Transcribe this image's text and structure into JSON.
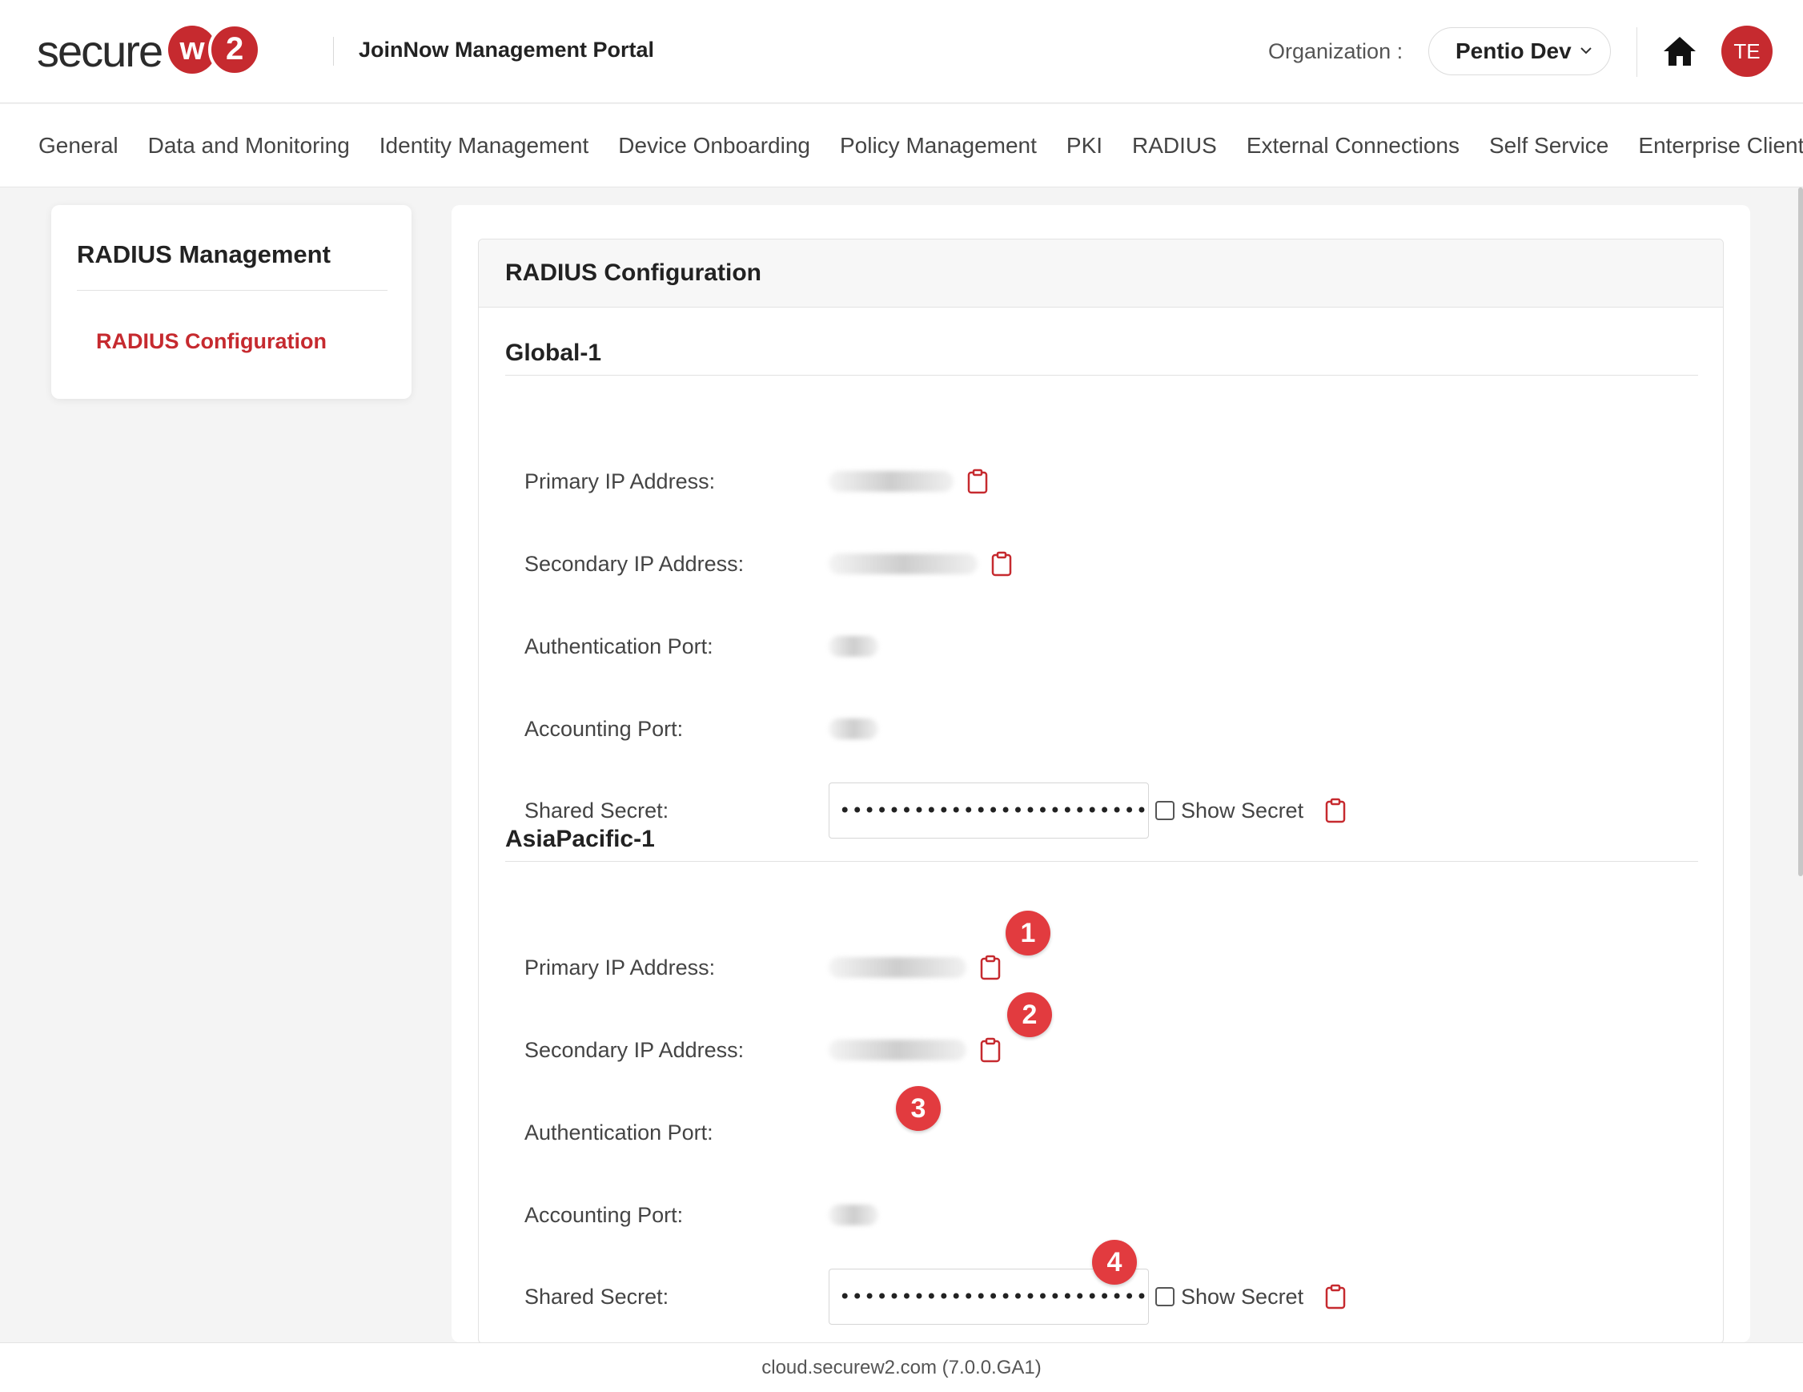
{
  "brand": {
    "logo_word": "secure",
    "logo_w": "w",
    "logo_2": "2",
    "accent_color": "#c62a2f"
  },
  "header": {
    "portal_title": "JoinNow Management Portal",
    "org_label": "Organization :",
    "org_value": "Pentio Dev",
    "avatar_initials": "TE"
  },
  "nav": {
    "items": [
      "General",
      "Data and Monitoring",
      "Identity Management",
      "Device Onboarding",
      "Policy Management",
      "PKI",
      "RADIUS",
      "External Connections",
      "Self Service",
      "Enterprise Client"
    ]
  },
  "sidebar": {
    "title": "RADIUS Management",
    "link": "RADIUS Configuration"
  },
  "card": {
    "title": "RADIUS Configuration"
  },
  "sections": [
    {
      "title": "Global-1",
      "primary_ip_label": "Primary IP Address:",
      "secondary_ip_label": "Secondary IP Address:",
      "auth_port_label": "Authentication Port:",
      "acct_port_label": "Accounting Port:",
      "shared_secret_label": "Shared Secret:",
      "shared_secret_value": "••••••••••••••••••••••••••••••",
      "show_secret_label": "Show Secret"
    },
    {
      "title": "AsiaPacific-1",
      "primary_ip_label": "Primary IP Address:",
      "secondary_ip_label": "Secondary IP Address:",
      "auth_port_label": "Authentication Port:",
      "acct_port_label": "Accounting Port:",
      "shared_secret_label": "Shared Secret:",
      "shared_secret_value": "••••••••••••••••••••••••••••••",
      "show_secret_label": "Show Secret"
    }
  ],
  "annotations": [
    "1",
    "2",
    "3",
    "4"
  ],
  "footer": {
    "text": "cloud.securew2.com (7.0.0.GA1)"
  },
  "icons": [
    "chevron-down-icon",
    "home-icon",
    "clipboard-icon"
  ]
}
